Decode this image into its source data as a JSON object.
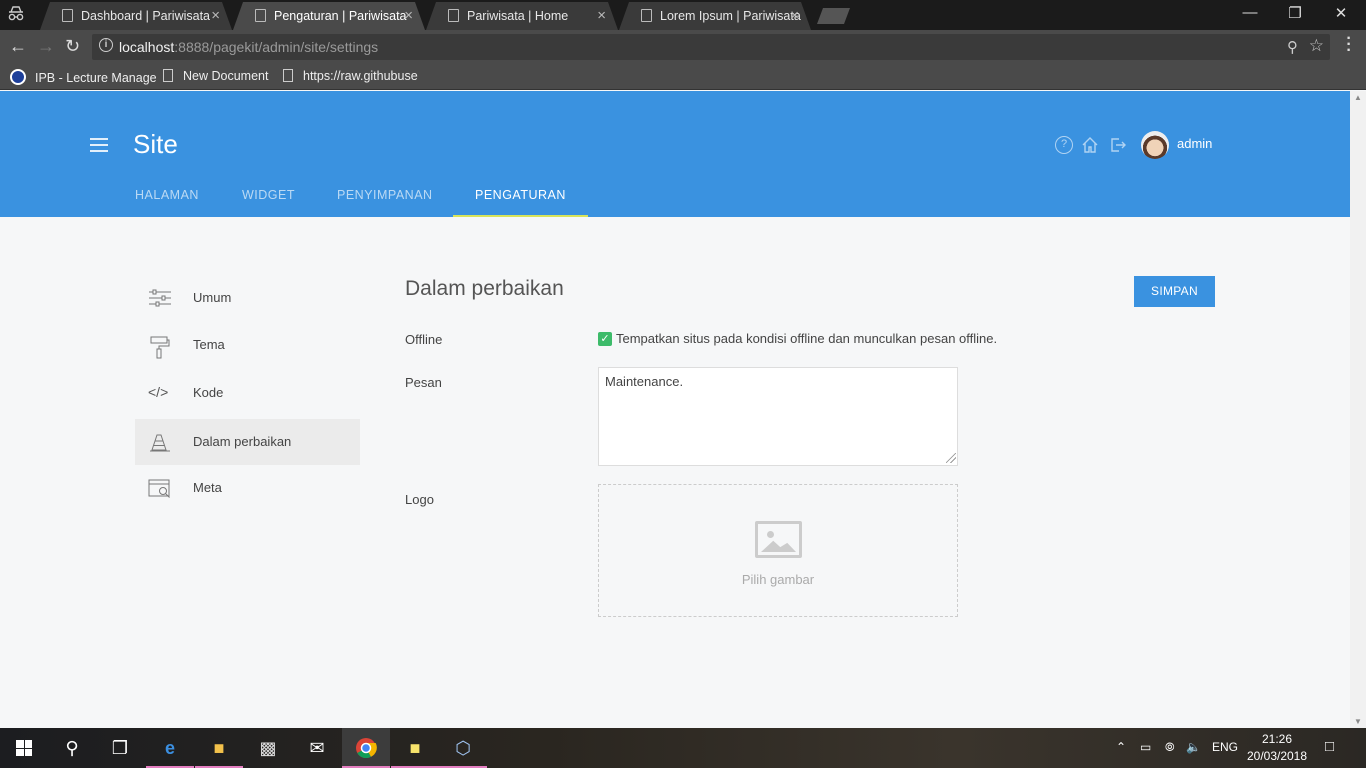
{
  "browser": {
    "tabs": [
      {
        "label": "Dashboard | Pariwisata",
        "active": false
      },
      {
        "label": "Pengaturan | Pariwisata",
        "active": true
      },
      {
        "label": "Pariwisata | Home",
        "active": false
      },
      {
        "label": "Lorem Ipsum | Pariwisata",
        "active": false
      }
    ],
    "url_host": "localhost",
    "url_path": ":8888/pagekit/admin/site/settings",
    "bookmarks": [
      "IPB - Lecture Manage",
      "New Document",
      "https://raw.githubuse"
    ]
  },
  "header": {
    "title": "Site",
    "user": "admin",
    "icons": [
      "help-icon",
      "home-icon",
      "logout-icon"
    ]
  },
  "nav": [
    {
      "label": "HALAMAN"
    },
    {
      "label": "WIDGET"
    },
    {
      "label": "PENYIMPANAN"
    },
    {
      "label": "PENGATURAN",
      "active": true
    }
  ],
  "sidebar": [
    {
      "label": "Umum",
      "icon": "sliders-icon"
    },
    {
      "label": "Tema",
      "icon": "paint-roller-icon"
    },
    {
      "label": "Kode",
      "icon": "code-icon"
    },
    {
      "label": "Dalam perbaikan",
      "icon": "traffic-cone-icon",
      "active": true
    },
    {
      "label": "Meta",
      "icon": "browser-search-icon"
    }
  ],
  "main": {
    "title": "Dalam perbaikan",
    "save_label": "SIMPAN",
    "offline_label": "Offline",
    "offline_checkbox_label": "Tempatkan situs pada kondisi offline dan munculkan pesan offline.",
    "offline_checked": true,
    "message_label": "Pesan",
    "message_value": "Maintenance.",
    "logo_label": "Logo",
    "pick_image_label": "Pilih gambar"
  },
  "taskbar": {
    "language": "ENG",
    "time": "21:26",
    "date": "20/03/2018"
  },
  "colors": {
    "accent": "#3a92e0",
    "nav_underline": "#d8e45a",
    "checkbox": "#3dbb6a"
  }
}
